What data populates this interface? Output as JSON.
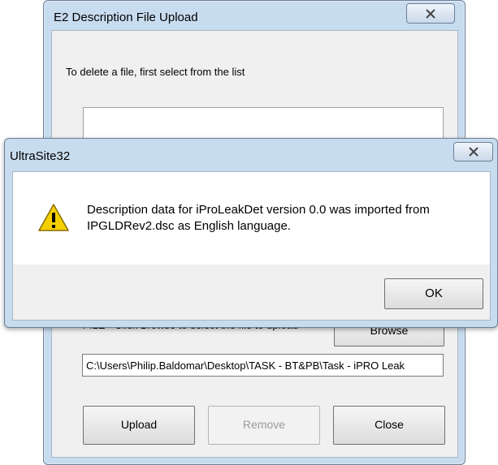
{
  "upload_dialog": {
    "title": "E2 Description File Upload",
    "instruction": "To delete a file, first select from the list",
    "file_hint": "FILE - Click Browse to select the file to upload",
    "browse_label": "Browse",
    "file_path": "C:\\Users\\Philip.Baldomar\\Desktop\\TASK - BT&PB\\Task - iPRO Leak",
    "upload_label": "Upload",
    "remove_label": "Remove",
    "close_label": "Close",
    "close_icon": "close-icon"
  },
  "message_box": {
    "title": "UltraSite32",
    "message_line1": "Description data for iProLeakDet version 0.0 was imported from",
    "message_line2": "IPGLDRev2.dsc as English language.",
    "ok_label": "OK",
    "icon": "warning-icon",
    "close_icon": "close-icon"
  },
  "colors": {
    "frame": "#c8dcef",
    "warning_yellow": "#f5d000"
  }
}
